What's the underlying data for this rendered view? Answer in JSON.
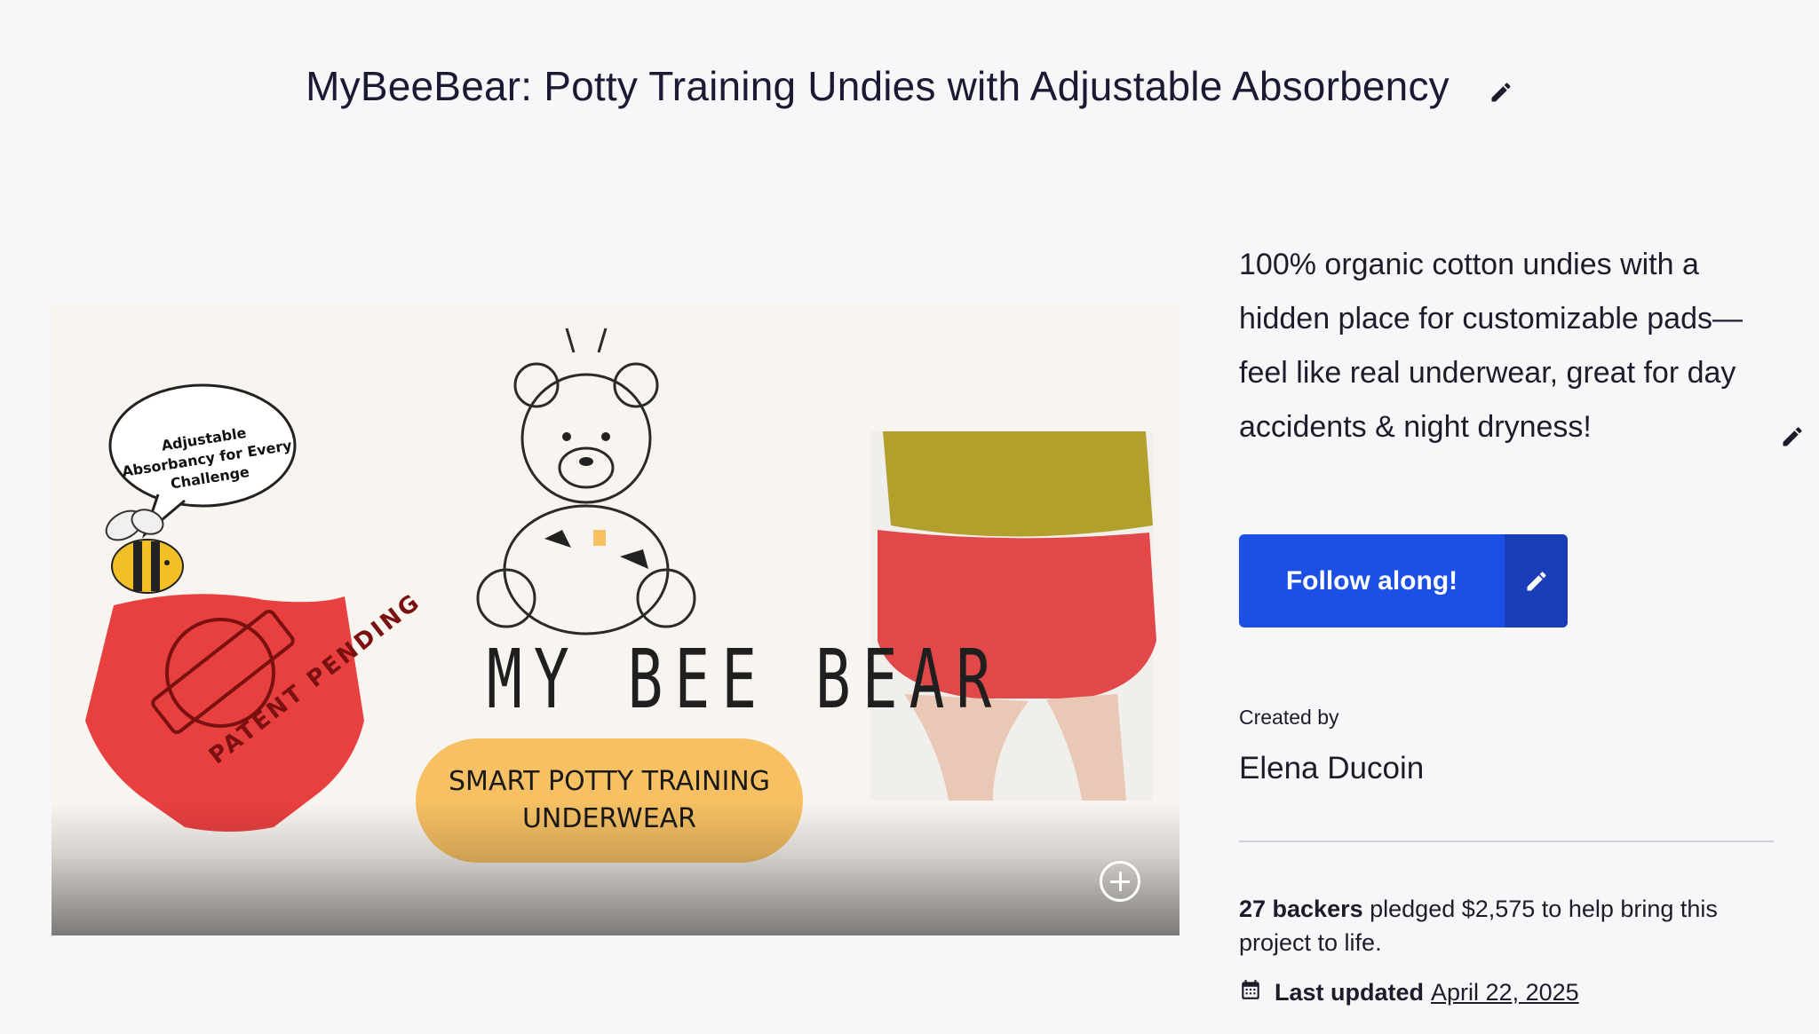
{
  "project": {
    "title": "MyBeeBear: Potty Training Undies with Adjustable Absorbency",
    "description": "100% organic cotton undies with a hidden place for customizable pads—feel like real underwear, great for day accidents & night dryness!"
  },
  "media": {
    "speech_bubble": "Adjustable Absorbancy for Every Challenge",
    "stamp": "PATENT PENDING",
    "brand": "MY BEE BEAR",
    "tagline": "SMART POTTY TRAINING UNDERWEAR"
  },
  "actions": {
    "follow_label": "Follow along!"
  },
  "creator": {
    "label": "Created by",
    "name": "Elena Ducoin"
  },
  "stats": {
    "backers": "27 backers",
    "pledged_text": " pledged $2,575 to help bring this project to life.",
    "last_updated_label": "Last updated",
    "last_updated_date": "April 22, 2025"
  },
  "icons": {
    "edit": "pencil-icon",
    "expand": "plus-circle-icon",
    "calendar": "calendar-icon"
  },
  "colors": {
    "background": "#f7f7f9",
    "primary_button": "#1b4fe6",
    "primary_button_dark": "#1a3db8",
    "underwear_red": "#e8403f",
    "pill_yellow": "#f6c063"
  }
}
